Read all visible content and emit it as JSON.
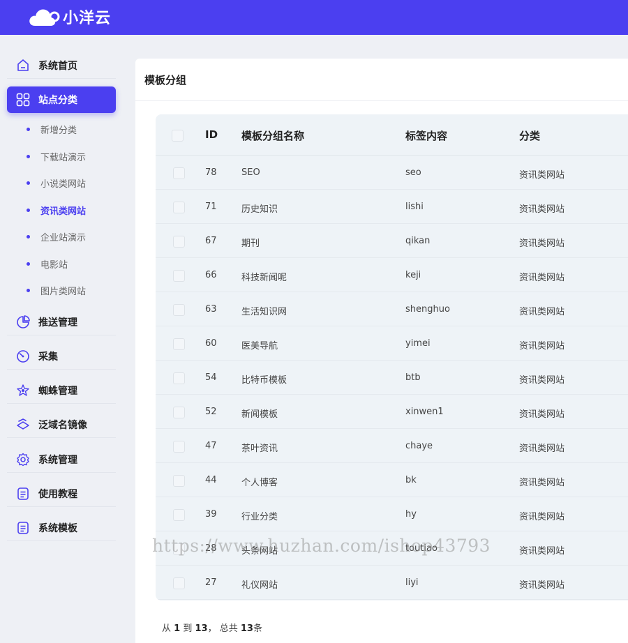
{
  "header": {
    "logo_text": "小洋云"
  },
  "sidebar": {
    "items": [
      {
        "label": "系统首页",
        "icon": "home-icon"
      },
      {
        "label": "站点分类",
        "icon": "grid-icon",
        "active": true
      },
      {
        "label": "推送管理",
        "icon": "pie-chart-icon"
      },
      {
        "label": "采集",
        "icon": "gauge-icon"
      },
      {
        "label": "蜘蛛管理",
        "icon": "spider-icon"
      },
      {
        "label": "泛域名镜像",
        "icon": "layers-icon"
      },
      {
        "label": "系统管理",
        "icon": "gear-icon"
      },
      {
        "label": "使用教程",
        "icon": "document-icon"
      },
      {
        "label": "系统模板",
        "icon": "document-icon"
      }
    ],
    "subitems": [
      {
        "label": "新增分类"
      },
      {
        "label": "下载站演示"
      },
      {
        "label": "小说类网站"
      },
      {
        "label": "资讯类网站",
        "active": true
      },
      {
        "label": "企业站演示"
      },
      {
        "label": "电影站"
      },
      {
        "label": "图片类网站"
      }
    ]
  },
  "main": {
    "title": "模板分组",
    "table": {
      "columns": [
        "ID",
        "模板分组名称",
        "标签内容",
        "分类"
      ],
      "rows": [
        {
          "id": "78",
          "name": "SEO",
          "tag": "seo",
          "category": "资讯类网站"
        },
        {
          "id": "71",
          "name": "历史知识",
          "tag": "lishi",
          "category": "资讯类网站"
        },
        {
          "id": "67",
          "name": "期刊",
          "tag": "qikan",
          "category": "资讯类网站"
        },
        {
          "id": "66",
          "name": "科技新闻呢",
          "tag": "keji",
          "category": "资讯类网站"
        },
        {
          "id": "63",
          "name": "生活知识网",
          "tag": "shenghuo",
          "category": "资讯类网站"
        },
        {
          "id": "60",
          "name": "医美导航",
          "tag": "yimei",
          "category": "资讯类网站"
        },
        {
          "id": "54",
          "name": "比特币模板",
          "tag": "btb",
          "category": "资讯类网站"
        },
        {
          "id": "52",
          "name": "新闻模板",
          "tag": "xinwen1",
          "category": "资讯类网站"
        },
        {
          "id": "47",
          "name": "茶叶资讯",
          "tag": "chaye",
          "category": "资讯类网站"
        },
        {
          "id": "44",
          "name": "个人博客",
          "tag": "bk",
          "category": "资讯类网站"
        },
        {
          "id": "39",
          "name": "行业分类",
          "tag": "hy",
          "category": "资讯类网站"
        },
        {
          "id": "28",
          "name": "头条网站",
          "tag": "toutiao",
          "category": "资讯类网站"
        },
        {
          "id": "27",
          "name": "礼仪网站",
          "tag": "liyi",
          "category": "资讯类网站"
        }
      ]
    },
    "pager": {
      "prefix": "从",
      "from": "1",
      "to_word": "到",
      "to": "13",
      "mid": "， 总共",
      "total": "13",
      "suffix": "条"
    }
  },
  "watermark": "https://www.huzhan.com/ishop43793",
  "colors": {
    "accent": "#4b3ff0",
    "background": "#eef0f5",
    "table_bg": "#eef3f7"
  }
}
